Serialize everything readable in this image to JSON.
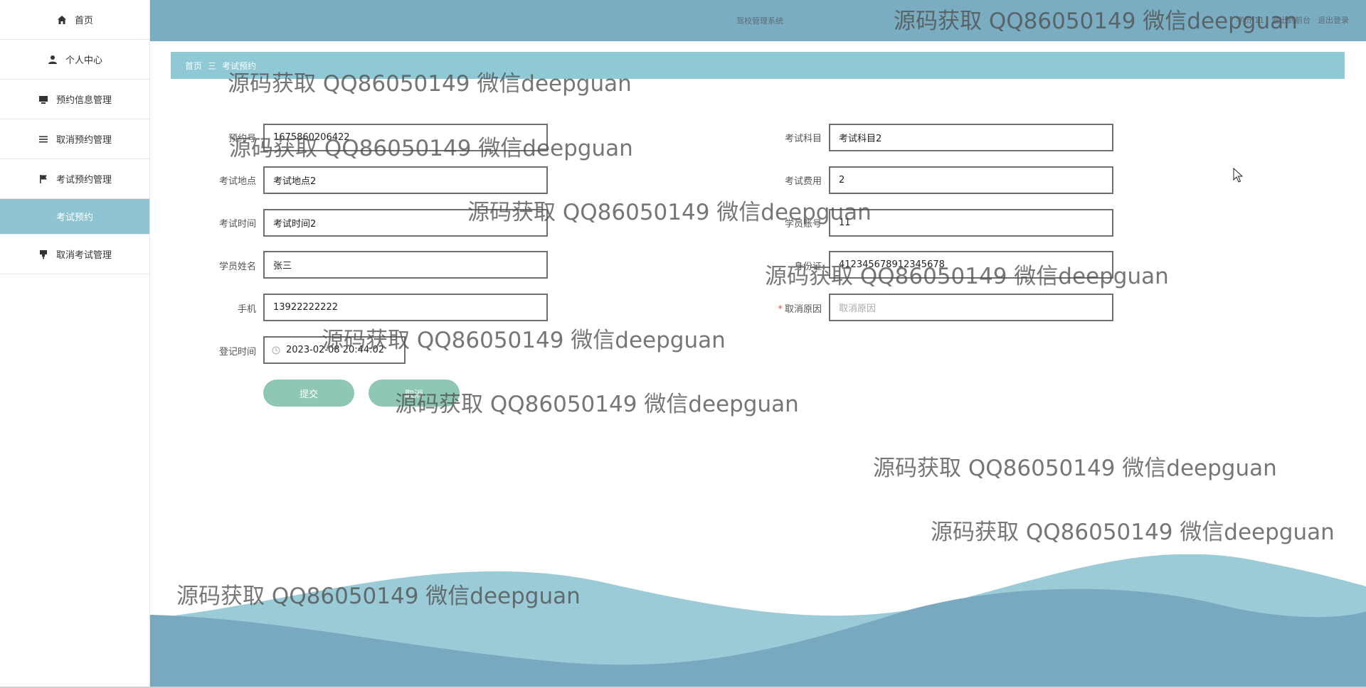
{
  "app": {
    "system_title": "驾校管理系统",
    "top_links": [
      "学员 11",
      "退出到前台",
      "退出登录"
    ]
  },
  "sidebar": {
    "items": [
      {
        "label": "首页",
        "icon": "home-icon"
      },
      {
        "label": "个人中心",
        "icon": "user-icon"
      },
      {
        "label": "预约信息管理",
        "icon": "monitor-icon"
      },
      {
        "label": "取消预约管理",
        "icon": "list-icon"
      },
      {
        "label": "考试预约管理",
        "icon": "flag-icon"
      },
      {
        "label": "取消考试管理",
        "icon": "pin-icon"
      }
    ],
    "active_sub": "考试预约"
  },
  "breadcrumb": {
    "home": "首页",
    "separator": "三",
    "current": "考试预约"
  },
  "form": {
    "yuyuehao": {
      "label": "预约号",
      "value": "1675860206422"
    },
    "kaoshikemu": {
      "label": "考试科目",
      "value": "考试科目2"
    },
    "kaoshididian": {
      "label": "考试地点",
      "value": "考试地点2"
    },
    "kaoshifeiyong": {
      "label": "考试费用",
      "value": "2"
    },
    "kaoshishijian": {
      "label": "考试时间",
      "value": "考试时间2"
    },
    "xueyuanzhanghao": {
      "label": "学员账号",
      "value": "11"
    },
    "xueyuanxingming": {
      "label": "学员姓名",
      "value": "张三"
    },
    "shenfenzheng": {
      "label": "身份证",
      "value": "412345678912345678"
    },
    "shouji": {
      "label": "手机",
      "value": "13922222222"
    },
    "quxiaoyuanyin": {
      "label": "取消原因",
      "placeholder": "取消原因"
    },
    "dengjishijian": {
      "label": "登记时间",
      "value": "2023-02-08 20:44:02"
    },
    "submit_label": "提交",
    "cancel_label": "取消"
  },
  "watermark": "源码获取 QQ86050149 微信deepguan",
  "colors": {
    "header": "#7aadc2",
    "breadcrumb": "#8fc9d5",
    "sidebar_active": "#8fc4d3",
    "button": "#8ec7b5",
    "wave_light": "#9ccbd8",
    "wave_dark": "#78a9c0"
  }
}
